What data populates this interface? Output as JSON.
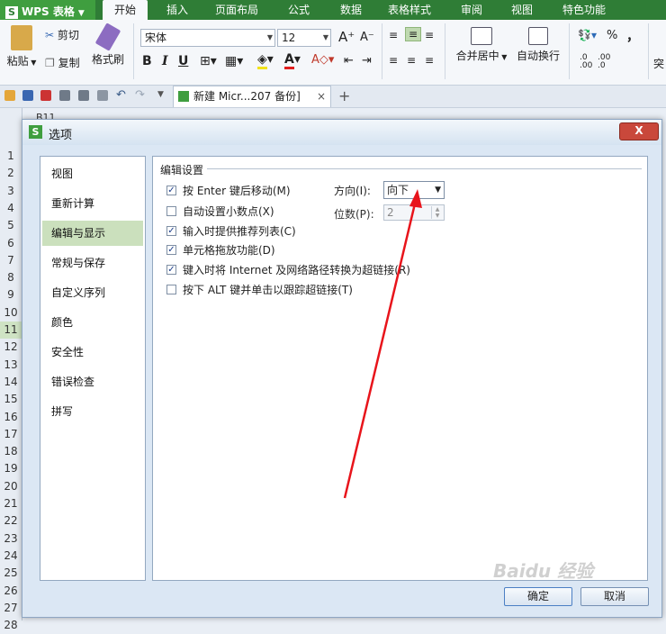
{
  "app": {
    "name": "WPS 表格"
  },
  "ribbon_tabs": [
    "开始",
    "插入",
    "页面布局",
    "公式",
    "数据",
    "表格样式",
    "审阅",
    "视图",
    "特色功能"
  ],
  "ribbon": {
    "paste": "粘贴",
    "cut": "剪切",
    "copy": "复制",
    "format_painter": "格式刷",
    "font_name": "宋体",
    "font_size": "12",
    "bold": "B",
    "italic": "I",
    "underline": "U",
    "merge_center": "合并居中",
    "wrap_text": "自动换行",
    "percent": "%",
    "comma": "，",
    "cut_right": "突"
  },
  "doc_tab": {
    "label": "新建 Micr...207 备份]"
  },
  "sheet": {
    "namebox": "B11",
    "rows": [
      "1",
      "2",
      "3",
      "4",
      "5",
      "6",
      "7",
      "8",
      "9",
      "10",
      "11",
      "12",
      "13",
      "14",
      "15",
      "16",
      "17",
      "18",
      "19",
      "20",
      "21",
      "22",
      "23",
      "24",
      "25",
      "26",
      "27",
      "28"
    ],
    "selected_row": "11"
  },
  "dialog": {
    "title": "选项",
    "close": "X",
    "nav": [
      "视图",
      "重新计算",
      "编辑与显示",
      "常规与保存",
      "自定义序列",
      "颜色",
      "安全性",
      "错误检查",
      "拼写"
    ],
    "active_nav": "编辑与显示",
    "group_title": "编辑设置",
    "options": [
      {
        "label": "按 Enter 键后移动(M)",
        "checked": true
      },
      {
        "label": "自动设置小数点(X)",
        "checked": false
      },
      {
        "label": "输入时提供推荐列表(C)",
        "checked": true
      },
      {
        "label": "单元格拖放功能(D)",
        "checked": true
      },
      {
        "label": "键入时将 Internet 及网络路径转换为超链接(R)",
        "checked": true
      },
      {
        "label": "按下 ALT 键并单击以跟踪超链接(T)",
        "checked": false
      }
    ],
    "direction_label": "方向(I):",
    "direction_value": "向下",
    "digits_label": "位数(P):",
    "digits_value": "2",
    "ok": "确定",
    "cancel": "取消"
  },
  "annotation": {
    "arrow_color": "#e8141b"
  },
  "watermark": "Baidu 经验"
}
